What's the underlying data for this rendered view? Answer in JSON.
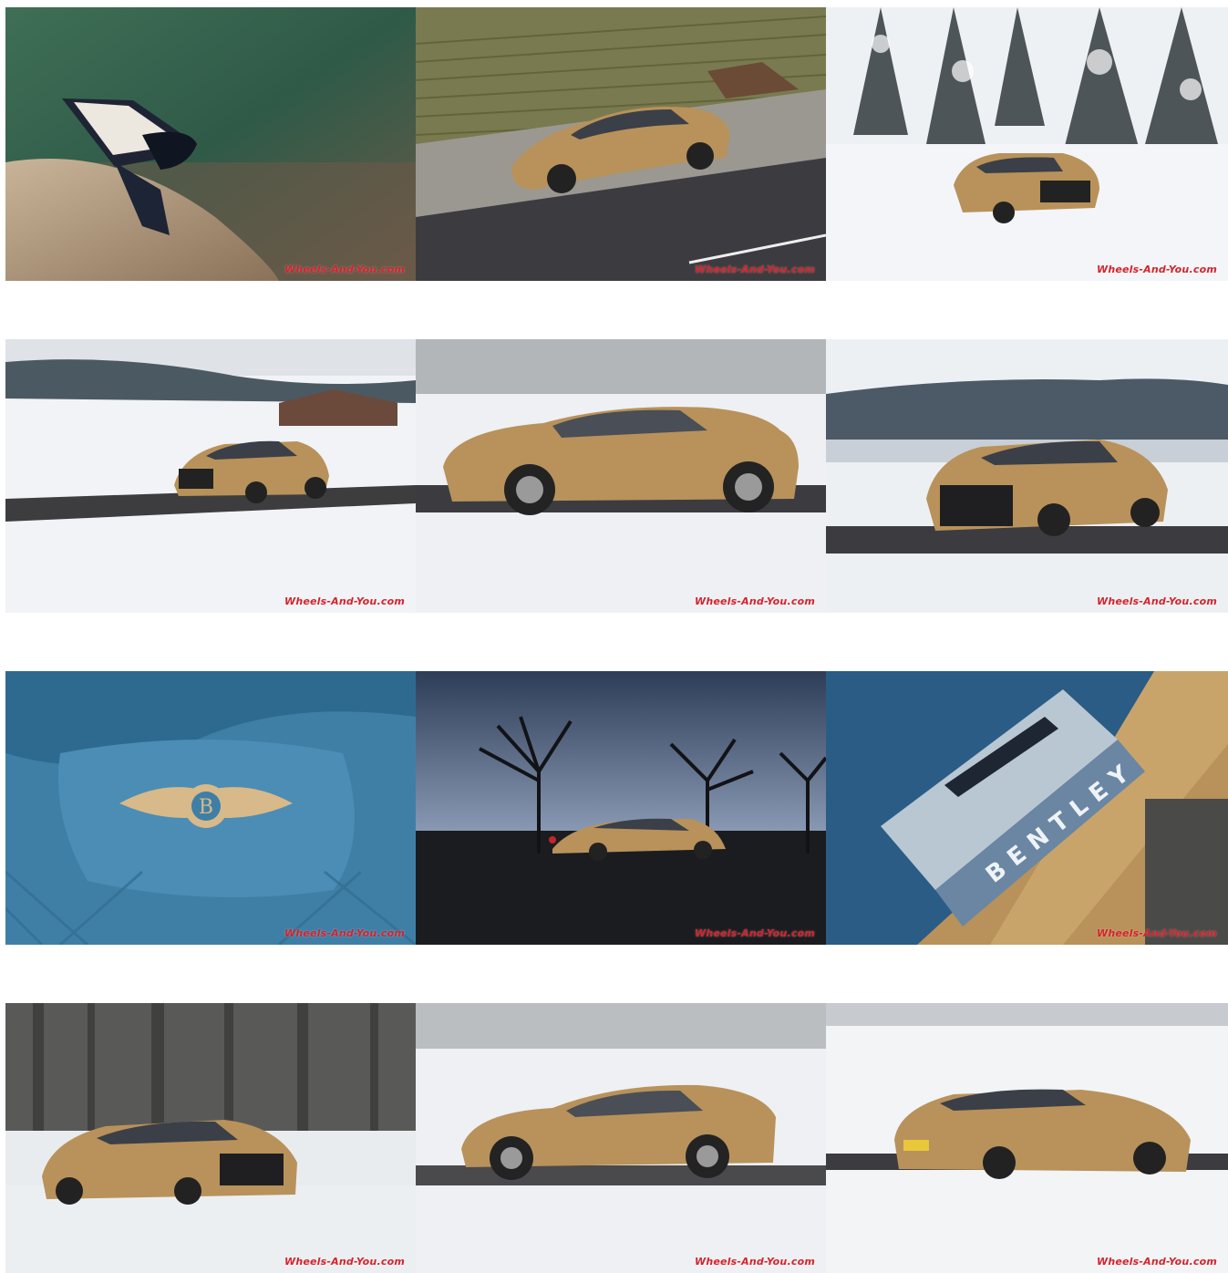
{
  "gallery": {
    "watermark": "Wheels-And-You.com",
    "tiles": [
      {
        "id": 1,
        "subject": "bonnet-mascot"
      },
      {
        "id": 2,
        "subject": "car-on-vineyard-road"
      },
      {
        "id": 3,
        "subject": "car-in-snow-forest"
      },
      {
        "id": 4,
        "subject": "car-front-snow-field"
      },
      {
        "id": 5,
        "subject": "car-side-panning"
      },
      {
        "id": 6,
        "subject": "car-front-three-quarter"
      },
      {
        "id": 7,
        "subject": "seat-embroidered-logo"
      },
      {
        "id": 8,
        "subject": "car-lakeside-trees"
      },
      {
        "id": 9,
        "subject": "illuminated-sill-plate"
      },
      {
        "id": 10,
        "subject": "car-panning-forest"
      },
      {
        "id": 11,
        "subject": "car-side-snow"
      },
      {
        "id": 12,
        "subject": "car-rear-three-quarter"
      }
    ],
    "sill_plate_text": "BENTLEY"
  },
  "colors": {
    "car_gold": "#b8925a",
    "watermark_red": "#d6222b",
    "seat_blue": "#3f7fa6"
  }
}
